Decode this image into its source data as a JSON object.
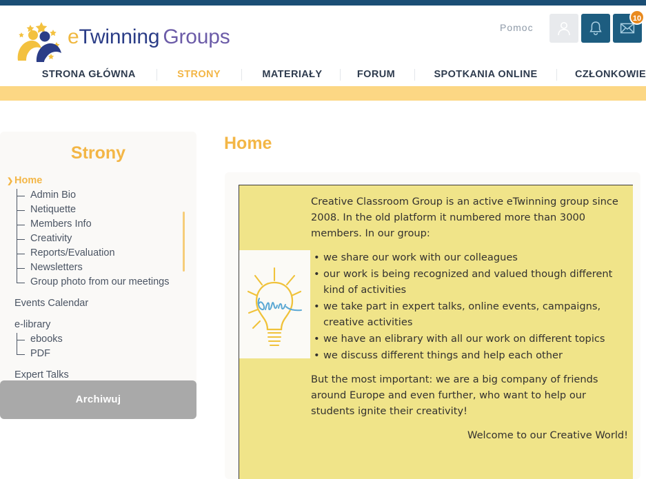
{
  "brand": {
    "logo_text_1": "e",
    "logo_text_2": "Twinning",
    "logo_text_3": "Groups",
    "logo_icon": "etwinning-people-stars-logo",
    "accent_yellow": "#f3b646",
    "accent_navy": "#2b3d87",
    "accent_purple": "#6c5ca8",
    "topbar_color": "#1b4e75",
    "band_color": "#fcd784"
  },
  "header": {
    "help_label": "Pomoc",
    "icons": [
      {
        "name": "user-icon",
        "label": "Profil"
      },
      {
        "name": "bell-icon",
        "label": "Powiadomienia"
      },
      {
        "name": "envelope-icon",
        "label": "Wiadomości"
      }
    ],
    "mail_badge_count": "10",
    "badge_color": "#e98a1f"
  },
  "nav": {
    "items": [
      {
        "label": "STRONA GŁÓWNA",
        "active": false
      },
      {
        "label": "STRONY",
        "active": true
      },
      {
        "label": "MATERIAŁY",
        "active": false
      },
      {
        "label": "FORUM",
        "active": false
      },
      {
        "label": "SPOTKANIA ONLINE",
        "active": false
      },
      {
        "label": "CZŁONKOWIE",
        "active": false
      }
    ]
  },
  "sidebar": {
    "title": "Strony",
    "archive_button": "Archiwuj",
    "items": [
      {
        "label": "Home",
        "level": 0,
        "active": true
      },
      {
        "label": "Admin Bio",
        "level": 1
      },
      {
        "label": "Netiquette",
        "level": 1
      },
      {
        "label": "Members Info",
        "level": 1
      },
      {
        "label": "Creativity",
        "level": 1
      },
      {
        "label": "Reports/Evaluation",
        "level": 1
      },
      {
        "label": "Newsletters",
        "level": 1
      },
      {
        "label": "Group photo from our meetings",
        "level": 1,
        "last": true
      },
      {
        "label": "Events Calendar",
        "level": 0
      },
      {
        "label": "e-library",
        "level": 0
      },
      {
        "label": "ebooks",
        "level": 1
      },
      {
        "label": "PDF",
        "level": 1,
        "last": true
      },
      {
        "label": "Expert Talks",
        "level": 0
      }
    ]
  },
  "main": {
    "page_title": "Home",
    "image_alt": "lightbulb-classroom-drawing",
    "intro": "Creative Classroom Group is an active eTwinning group since 2008. In the old platform it numbered more than 3000 members.  In our group:",
    "bullets": [
      "we share our work with our colleagues",
      "our work is being recognized and valued though different kind of activities",
      "we take part in expert talks, online events, campaigns, creative activities",
      "we have an elibrary with all our work on different topics",
      "we discuss different things and help each other"
    ],
    "closing": "But the most important: we are a big company of friends around Europe and even further, who want to help our students ignite their creativity!",
    "welcome": "Welcome to our Creative World!"
  }
}
